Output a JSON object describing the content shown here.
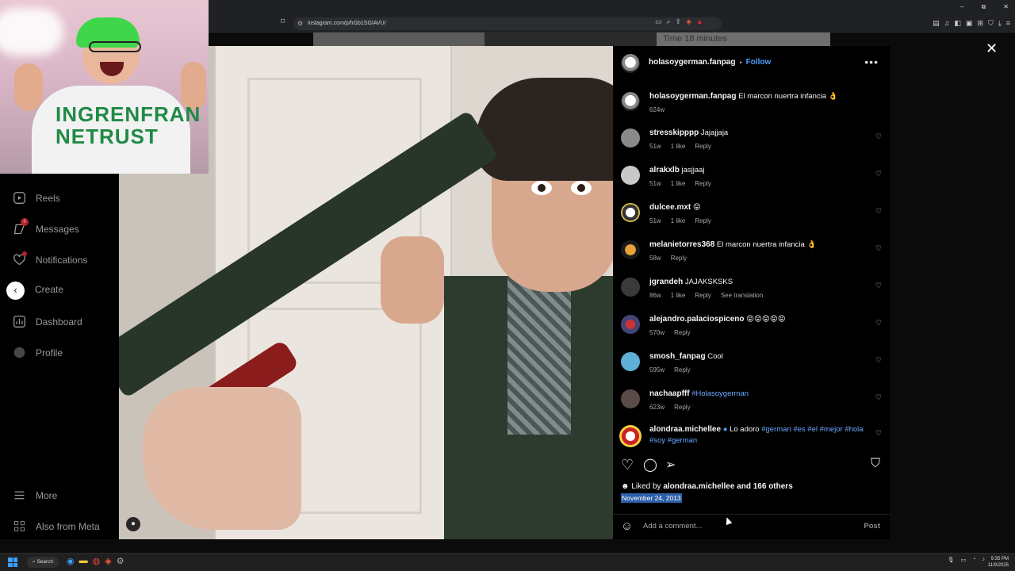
{
  "browser": {
    "url": "instagram.com/p/hGb1SGIAVU/",
    "window_controls": [
      "–",
      "⧉",
      "✕"
    ]
  },
  "webcam": {
    "shirt_text": "INGRENFRAN NETRUST"
  },
  "background_strip": {
    "label": "Time 18 minutes"
  },
  "sidebar": {
    "items": [
      {
        "label": "Reels",
        "icon": "reels-icon"
      },
      {
        "label": "Messages",
        "icon": "messages-icon",
        "badge": "8"
      },
      {
        "label": "Notifications",
        "icon": "heart-icon"
      },
      {
        "label": "Create",
        "icon": "create-icon"
      },
      {
        "label": "Dashboard",
        "icon": "dashboard-icon"
      },
      {
        "label": "Profile",
        "icon": "profile-icon"
      }
    ],
    "bottom": [
      {
        "label": "More",
        "icon": "hamburger-icon"
      },
      {
        "label": "Also from Meta",
        "icon": "meta-icon"
      }
    ]
  },
  "post": {
    "username": "holasoygerman.fanpag",
    "follow_label": "Follow",
    "caption_user": "holasoygerman.fanpag",
    "caption_text": "El marcon nuertra infancia 👌",
    "caption_age": "624w",
    "comments": [
      {
        "user": "stresskipppp",
        "text": "Jajajjaja",
        "age": "51w",
        "likes": "1 like",
        "reply": "Reply"
      },
      {
        "user": "alrakxlb",
        "text": "jasjjaaj",
        "age": "51w",
        "likes": "1 like",
        "reply": "Reply"
      },
      {
        "user": "dulcee.mxt",
        "text": "😝",
        "age": "51w",
        "likes": "1 like",
        "reply": "Reply"
      },
      {
        "user": "melanietorres368",
        "text": "El marcon nuertra infancia 👌",
        "age": "58w",
        "likes": "",
        "reply": "Reply"
      },
      {
        "user": "jgrandeh",
        "text": "JAJAKSKSKS",
        "age": "86w",
        "likes": "1 like",
        "reply": "Reply",
        "extra": "See translation"
      },
      {
        "user": "alejandro.palaciospiceno",
        "text": "😝😝😝😝😝",
        "age": "570w",
        "likes": "",
        "reply": "Reply"
      },
      {
        "user": "smosh_fanpag",
        "text": "Cool",
        "age": "595w",
        "likes": "",
        "reply": "Reply"
      },
      {
        "user": "nachaapfff",
        "text": "#Holasoygerman",
        "age": "623w",
        "likes": "",
        "reply": "Reply"
      },
      {
        "user": "alondraa.michellee",
        "text": "Lo adoro",
        "tags": "#german #es #el #mejor #hola",
        "tags2": "#soy #german",
        "age": "",
        "likes": "",
        "reply": ""
      }
    ],
    "liked_by_prefix": "Liked by",
    "liked_by_user": "alondraa.michellee",
    "liked_by_suffix": "and 166 others",
    "date": "November 24, 2013",
    "add_comment_placeholder": "Add a comment...",
    "post_label": "Post"
  },
  "taskbar": {
    "search_label": "Search",
    "time": "9:35 PM",
    "date": "11/9/2025"
  },
  "colors": {
    "accent": "#4a9eff",
    "badge": "#ff3040",
    "selection": "#2c5fa8"
  }
}
